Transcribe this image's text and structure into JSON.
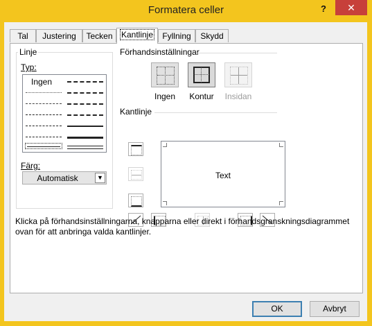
{
  "window": {
    "title": "Formatera celler",
    "help": "?",
    "close": "✕"
  },
  "tabs": [
    {
      "label": "Tal"
    },
    {
      "label": "Justering"
    },
    {
      "label": "Tecken"
    },
    {
      "label": "Kantlinje"
    },
    {
      "label": "Fyllning"
    },
    {
      "label": "Skydd"
    }
  ],
  "line": {
    "group_label": "Linje",
    "type_label": "Typ:",
    "none_label": "Ingen",
    "color_label": "Färg:",
    "color_value": "Automatisk"
  },
  "presets": {
    "label": "Förhandsinställningar",
    "items": [
      {
        "label": "Ingen"
      },
      {
        "label": "Kontur"
      },
      {
        "label": "Insidan"
      }
    ]
  },
  "border": {
    "label": "Kantlinje",
    "preview_text": "Text"
  },
  "hint": "Klicka på förhandsinställningarna, knapparna eller direkt i förhandsgranskningsdiagrammet ovan för att anbringa valda kantlinjer.",
  "buttons": {
    "ok": "OK",
    "cancel": "Avbryt"
  },
  "colors": {
    "title_bar": "#f3c51e",
    "close": "#c7403a",
    "accent": "#3c7fb1"
  }
}
